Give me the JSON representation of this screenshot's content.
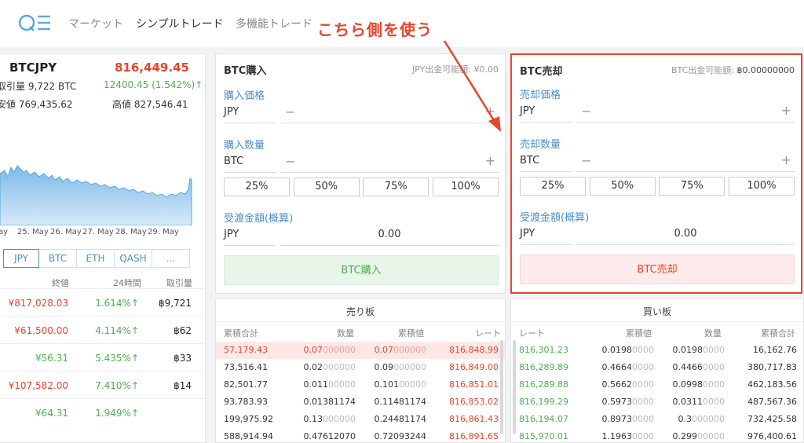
{
  "nav": {
    "items": [
      "マーケット",
      "シンプルトレード",
      "多機能トレード"
    ],
    "annotation": "こちら側を使う"
  },
  "ticker": {
    "pair": "BTCJPY",
    "price": "816,449.45",
    "volume": "取引量 9,722 BTC",
    "change": "12400.45 (1.542%)↑",
    "low": "安値 769,435.62",
    "high": "高値 827,546.41",
    "x_labels": [
      "ay",
      "25. May",
      "26. May",
      "27. May",
      "28. May",
      "29. May"
    ]
  },
  "pair_tabs": [
    "JPY",
    "BTC",
    "ETH",
    "QASH",
    "..."
  ],
  "market_table": {
    "headers": [
      "終値",
      "24時間",
      "取引量"
    ],
    "rows": [
      {
        "close": "¥817,028.03",
        "change": "1.614%↑",
        "volume": "฿9,721",
        "close_color": "red"
      },
      {
        "close": "¥61,500.00",
        "change": "4.114%↑",
        "volume": "฿62",
        "close_color": "red"
      },
      {
        "close": "¥56.31",
        "change": "5.435%↑",
        "volume": "฿33",
        "close_color": "green"
      },
      {
        "close": "¥107,582.00",
        "change": "7.410%↑",
        "volume": "฿14",
        "close_color": "red"
      },
      {
        "close": "¥64.31",
        "change": "1.949%↑",
        "volume": "",
        "close_color": "green"
      }
    ]
  },
  "buy": {
    "title": "BTC購入",
    "available": "JPY出金可能額: ¥0.00",
    "price_label": "購入価格",
    "price_currency": "JPY",
    "qty_label": "購入数量",
    "qty_currency": "BTC",
    "percents": [
      "25%",
      "50%",
      "75%",
      "100%"
    ],
    "total_label": "受渡金額(概算)",
    "total_currency": "JPY",
    "total_value": "0.00",
    "submit": "BTC購入"
  },
  "sell": {
    "title": "BTC売却",
    "available_label": "BTC出金可能額: ",
    "available_value": "฿0.00000000",
    "price_label": "売却価格",
    "price_currency": "JPY",
    "qty_label": "売却数量",
    "qty_currency": "BTC",
    "percents": [
      "25%",
      "50%",
      "75%",
      "100%"
    ],
    "total_label": "受渡金額(概算)",
    "total_currency": "JPY",
    "total_value": "0.00",
    "submit": "BTC売却"
  },
  "ask_book": {
    "title": "売り板",
    "headers": [
      "累積合計",
      "数量",
      "累積値",
      "レート"
    ],
    "rows": [
      {
        "total": "57,179.43",
        "qty": "0.07",
        "qty_dim": "000000",
        "cum": "0.07",
        "cum_dim": "000000",
        "rate": "816,848.99"
      },
      {
        "total": "73,516.41",
        "qty": "0.02",
        "qty_dim": "000000",
        "cum": "0.09",
        "cum_dim": "000000",
        "rate": "816,849.00"
      },
      {
        "total": "82,501.77",
        "qty": "0.011",
        "qty_dim": "00000",
        "cum": "0.101",
        "cum_dim": "00000",
        "rate": "816,851.01"
      },
      {
        "total": "93,783.93",
        "qty": "0.01381174",
        "qty_dim": "",
        "cum": "0.11481174",
        "cum_dim": "",
        "rate": "816,853.02"
      },
      {
        "total": "199,975.92",
        "qty": "0.13",
        "qty_dim": "000000",
        "cum": "0.24481174",
        "cum_dim": "",
        "rate": "816,861.43"
      },
      {
        "total": "588,914.94",
        "qty": "0.47612070",
        "qty_dim": "",
        "cum": "0.72093244",
        "cum_dim": "",
        "rate": "816,891.65"
      }
    ]
  },
  "bid_book": {
    "title": "買い板",
    "headers": [
      "レート",
      "累積値",
      "数量",
      "累積合計"
    ],
    "rows": [
      {
        "rate": "816,301.23",
        "cum": "0.0198",
        "cum_dim": "0000",
        "qty": "0.0198",
        "qty_dim": "0000",
        "total": "16,162.76"
      },
      {
        "rate": "816,289.89",
        "cum": "0.4664",
        "cum_dim": "0000",
        "qty": "0.4466",
        "qty_dim": "0000",
        "total": "380,717.83"
      },
      {
        "rate": "816,289.88",
        "cum": "0.5662",
        "cum_dim": "0000",
        "qty": "0.0998",
        "qty_dim": "0000",
        "total": "462,183.56"
      },
      {
        "rate": "816,199.29",
        "cum": "0.5973",
        "cum_dim": "0000",
        "qty": "0.0311",
        "qty_dim": "0000",
        "total": "487,567.36"
      },
      {
        "rate": "816,194.07",
        "cum": "0.8973",
        "cum_dim": "0000",
        "qty": "0.3",
        "qty_dim": "000000",
        "total": "732,425.58"
      },
      {
        "rate": "815,970.01",
        "cum": "1.1963",
        "cum_dim": "0000",
        "qty": "0.299",
        "qty_dim": "00000",
        "total": "976,400.61"
      }
    ]
  },
  "colors": {
    "accent": "#4a90c8",
    "red": "#e8452c",
    "green": "#4caf50"
  }
}
